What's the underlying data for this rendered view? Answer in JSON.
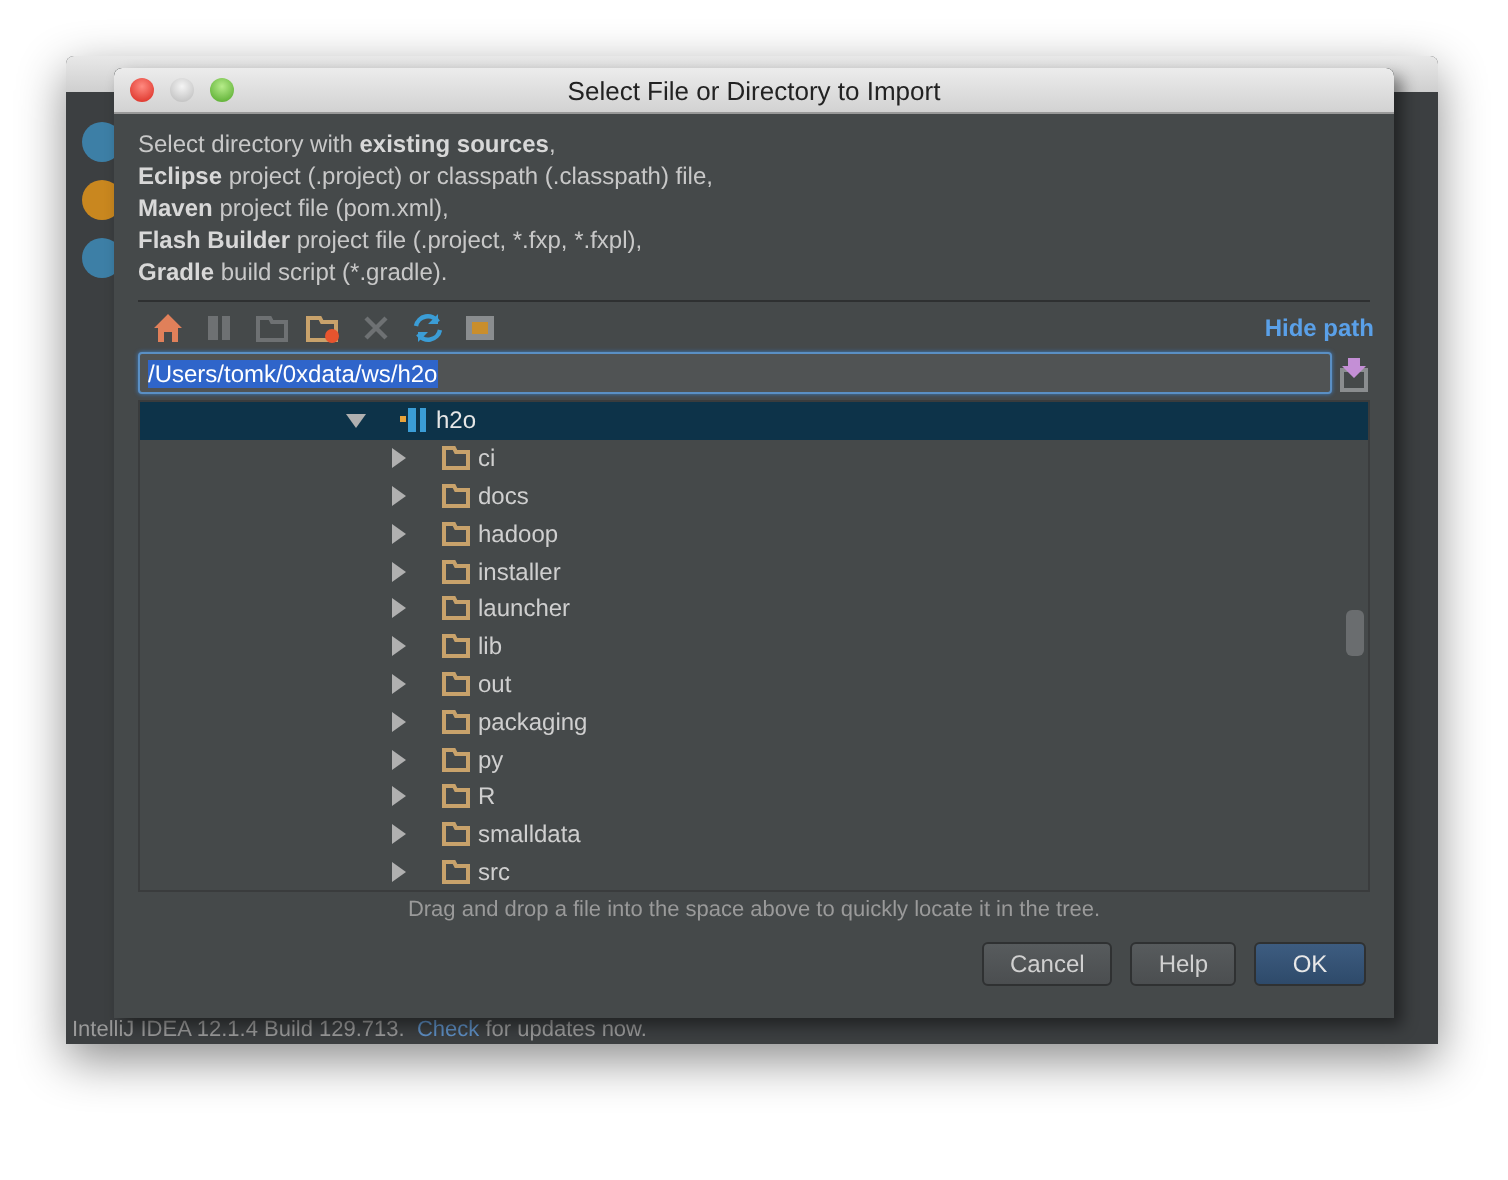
{
  "background_window": {
    "status": {
      "before": "IntelliJ IDEA 12.1.4 Build 129.713.",
      "link": "Check",
      "after": "for updates now."
    },
    "welcome_icons": [
      {
        "color": "#3d7fa6"
      },
      {
        "color": "#c9871f"
      },
      {
        "color": "#3d7fa6"
      }
    ]
  },
  "dialog": {
    "title": "Select File or Directory to Import",
    "intro": [
      "Select directory with **existing sources**,",
      "**Eclipse** project (.project) or classpath (.classpath) file,",
      "**Maven** project file (pom.xml),",
      "**Flash Builder** project file (.project, *.fxp, *.fxpl),",
      "**Gradle** build script (*.gradle)."
    ],
    "toolbar": [
      {
        "kind": "home",
        "disabled": false
      },
      {
        "kind": "module",
        "disabled": true
      },
      {
        "kind": "folder",
        "disabled": true
      },
      {
        "kind": "new-folder",
        "disabled": false
      },
      {
        "kind": "delete",
        "disabled": true
      },
      {
        "kind": "refresh",
        "disabled": false
      },
      {
        "kind": "hidden-files",
        "disabled": false
      }
    ],
    "hide_path_link": "Hide path",
    "path_field": {
      "value": "/Users/tomk/0xdata/ws/h2o",
      "selected": true
    },
    "tree": {
      "label": "h2o",
      "kind": "module",
      "expanded": true,
      "selected": true,
      "children": [
        {
          "label": "ci",
          "kind": "folder",
          "expanded": false,
          "selected": false
        },
        {
          "label": "docs",
          "kind": "folder",
          "expanded": false,
          "selected": false
        },
        {
          "label": "hadoop",
          "kind": "folder",
          "expanded": false,
          "selected": false
        },
        {
          "label": "installer",
          "kind": "folder",
          "expanded": false,
          "selected": false
        },
        {
          "label": "launcher",
          "kind": "folder",
          "expanded": false,
          "selected": false
        },
        {
          "label": "lib",
          "kind": "folder",
          "expanded": false,
          "selected": false
        },
        {
          "label": "out",
          "kind": "folder",
          "expanded": false,
          "selected": false
        },
        {
          "label": "packaging",
          "kind": "folder",
          "expanded": false,
          "selected": false
        },
        {
          "label": "py",
          "kind": "folder",
          "expanded": false,
          "selected": false
        },
        {
          "label": "R",
          "kind": "folder",
          "expanded": false,
          "selected": false
        },
        {
          "label": "smalldata",
          "kind": "folder",
          "expanded": false,
          "selected": false
        },
        {
          "label": "src",
          "kind": "folder",
          "expanded": false,
          "selected": false
        }
      ]
    },
    "hint": "Drag and drop a file into the space above to quickly locate it in the tree.",
    "buttons": [
      {
        "label": "Cancel",
        "default": false
      },
      {
        "label": "Help",
        "default": false
      },
      {
        "label": "OK",
        "default": true
      }
    ]
  }
}
